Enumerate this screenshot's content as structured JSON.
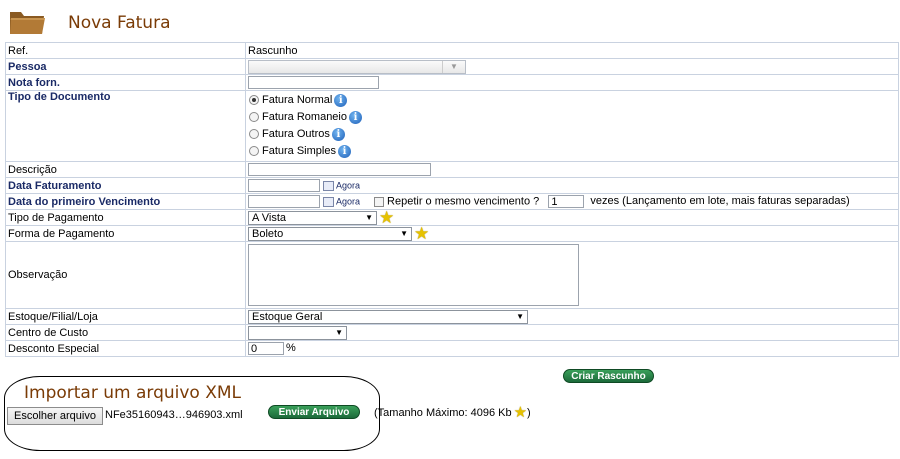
{
  "page": {
    "title": "Nova Fatura"
  },
  "fields": {
    "ref": {
      "label": "Ref.",
      "value": "Rascunho"
    },
    "pessoa": {
      "label": "Pessoa",
      "value": ""
    },
    "nota_forn": {
      "label": "Nota forn.",
      "value": ""
    },
    "tipo_documento": {
      "label": "Tipo de Documento",
      "options": [
        "Fatura Normal",
        "Fatura Romaneio",
        "Fatura Outros",
        "Fatura Simples"
      ],
      "selected": "Fatura Normal"
    },
    "descricao": {
      "label": "Descrição",
      "value": ""
    },
    "data_faturamento": {
      "label": "Data Faturamento",
      "value": "",
      "now_label": "Agora"
    },
    "data_primeiro_vencimento": {
      "label": "Data do primeiro Vencimento",
      "value": "",
      "now_label": "Agora",
      "repeat_label": "Repetir o mesmo vencimento ?",
      "repeat_checked": false,
      "times_value": "1",
      "times_label": "vezes (Lançamento em lote, mais faturas separadas)"
    },
    "tipo_pagamento": {
      "label": "Tipo de Pagamento",
      "value": "A Vista"
    },
    "forma_pagamento": {
      "label": "Forma de Pagamento",
      "value": "Boleto"
    },
    "observacao": {
      "label": "Observação",
      "value": ""
    },
    "estoque": {
      "label": "Estoque/Filial/Loja",
      "value": "Estoque Geral"
    },
    "centro_custo": {
      "label": "Centro de Custo",
      "value": ""
    },
    "desconto": {
      "label": "Desconto Especial",
      "value": "0",
      "unit": "%"
    }
  },
  "actions": {
    "criar_rascunho": "Criar Rascunho"
  },
  "xml_import": {
    "title": "Importar um arquivo XML",
    "choose_label": "Escolher arquivo",
    "file_name": "NFe35160943…946903.xml",
    "send_label": "Enviar Arquivo",
    "max_size_prefix": "(Tamanho Máximo: 4096 Kb",
    "max_size_suffix": ")"
  },
  "colors": {
    "title": "#7a3b06",
    "label_required": "#1a2a66",
    "button_green": "#1c6a3a"
  },
  "icons": [
    "folder-icon",
    "info-icon",
    "calendar-icon",
    "star-icon"
  ]
}
